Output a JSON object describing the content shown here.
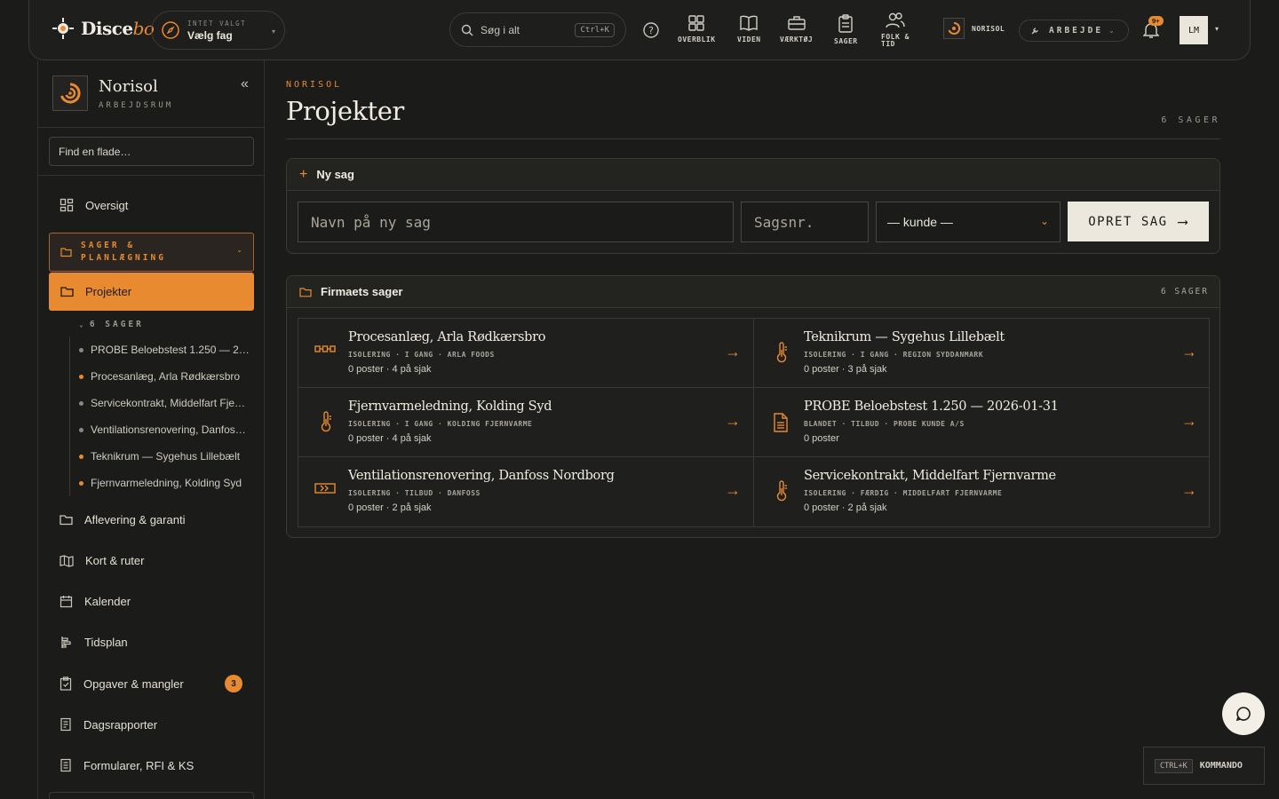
{
  "app": {
    "logo_text": "Disce",
    "logo_accent": "bo"
  },
  "topbar": {
    "trade_sub": "INTET VALGT",
    "trade_main": "Vælg fag",
    "search_label": "Søg i alt",
    "search_shortcut": "Ctrl+K",
    "nav": [
      {
        "label": "OVERBLIK",
        "icon": "grid-icon"
      },
      {
        "label": "VIDEN",
        "icon": "book-icon"
      },
      {
        "label": "VÆRKTØJ",
        "icon": "briefcase-icon"
      },
      {
        "label": "SAGER",
        "icon": "clipboard-icon"
      },
      {
        "label": "FOLK &",
        "label2": "TID",
        "icon": "people-icon"
      }
    ],
    "org_name": "NORISOL",
    "mode_label": "ARBEJDE",
    "notif_badge": "9+",
    "avatar_initials": "LM"
  },
  "sidebar": {
    "workspace_name": "Norisol",
    "workspace_sub": "ARBEJDSRUM",
    "find_placeholder": "Find en flade…",
    "overview": "Oversigt",
    "group_label_1": "SAGER &",
    "group_label_2": "PLANLÆGNING",
    "active_item": "Projekter",
    "sub_heading": "6 SAGER",
    "sub_items": [
      {
        "label": "PROBE Beloebstest 1.250 — 2…",
        "dot": "#8c897f"
      },
      {
        "label": "Procesanlæg, Arla Rødkærsbro",
        "dot": "#e88a2f"
      },
      {
        "label": "Servicekontrakt, Middelfart Fje…",
        "dot": "#8c897f"
      },
      {
        "label": "Ventilationsrenovering, Danfos…",
        "dot": "#8c897f"
      },
      {
        "label": "Teknikrum — Sygehus Lillebælt",
        "dot": "#e88a2f"
      },
      {
        "label": "Fjernvarmeledning, Kolding Syd",
        "dot": "#e88a2f"
      }
    ],
    "items": [
      {
        "label": "Aflevering & garanti",
        "icon": "folder-icon"
      },
      {
        "label": "Kort & ruter",
        "icon": "map-icon"
      },
      {
        "label": "Kalender",
        "icon": "calendar-icon"
      },
      {
        "label": "Tidsplan",
        "icon": "timeline-icon"
      },
      {
        "label": "Opgaver & mangler",
        "icon": "clipboard-check-icon",
        "badge": "3"
      },
      {
        "label": "Dagsrapporter",
        "icon": "report-icon"
      },
      {
        "label": "Formularer, RFI & KS",
        "icon": "form-icon"
      }
    ]
  },
  "main": {
    "eyebrow": "NORISOL",
    "title": "Projekter",
    "count": "6 SAGER",
    "new_case": {
      "title": "Ny sag",
      "name_placeholder": "Navn på ny sag",
      "number_placeholder": "Sagsnr.",
      "customer_select": "— kunde —",
      "create_label": "OPRET SAG"
    },
    "cases_card": {
      "title": "Firmaets sager",
      "count": "6 SAGER",
      "cases": [
        {
          "title": "Procesanlæg, Arla Rødkærsbro",
          "meta": "ISOLERING · I GANG · ARLA FOODS",
          "counts": "0 poster · 4 på sjak",
          "icon": "pipes-icon"
        },
        {
          "title": "Teknikrum — Sygehus Lillebælt",
          "meta": "ISOLERING · I GANG · REGION SYDDANMARK",
          "counts": "0 poster · 3 på sjak",
          "icon": "thermometer-icon"
        },
        {
          "title": "Fjernvarmeledning, Kolding Syd",
          "meta": "ISOLERING · I GANG · KOLDING FJERNVARME",
          "counts": "0 poster · 4 på sjak",
          "icon": "thermometer-icon"
        },
        {
          "title": "PROBE Beloebstest 1.250 — 2026-01-31",
          "meta": "BLANDET · TILBUD · PROBE KUNDE A/S",
          "counts": "0 poster",
          "icon": "document-icon"
        },
        {
          "title": "Ventilationsrenovering, Danfoss Nordborg",
          "meta": "ISOLERING · TILBUD · DANFOSS",
          "counts": "0 poster · 2 på sjak",
          "icon": "duct-icon"
        },
        {
          "title": "Servicekontrakt, Middelfart Fjernvarme",
          "meta": "ISOLERING · FÆRDIG · MIDDELFART FJERNVARME",
          "counts": "0 poster · 2 på sjak",
          "icon": "thermometer-icon"
        }
      ]
    }
  },
  "footer": {
    "cmd_shortcut": "CTRL+K",
    "cmd_label": "KOMMANDO"
  },
  "colors": {
    "accent": "#e88a2f",
    "background": "#1b1b19"
  }
}
